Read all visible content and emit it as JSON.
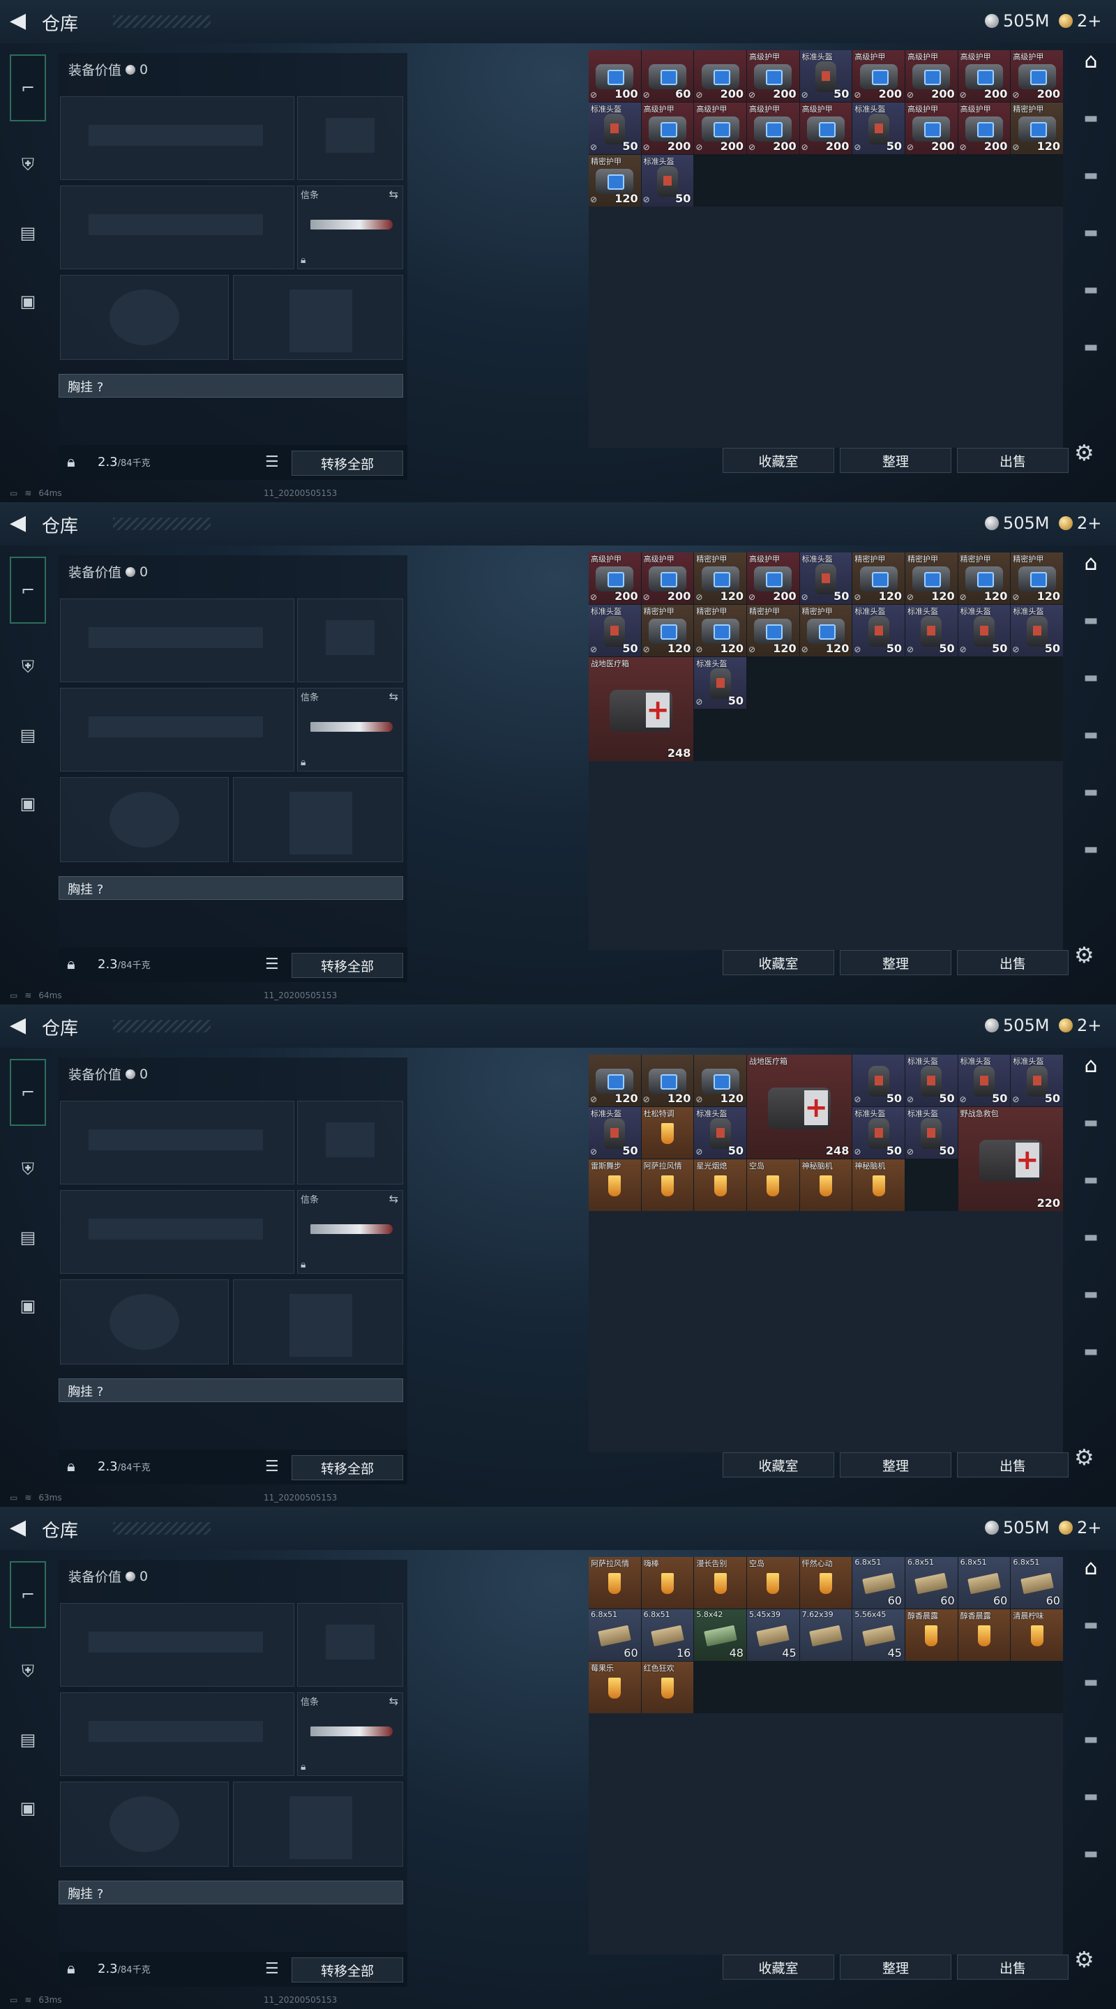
{
  "header": {
    "back": "<",
    "title": "仓库",
    "silver": "505M",
    "gold": "2+"
  },
  "left": {
    "equip_label": "装备价值",
    "equip_value": "0",
    "chest_label": "胸挂",
    "chest_q": "?",
    "knife_tag": "信条",
    "weight": "2.3",
    "weight_cap": "/84千克",
    "transfer": "转移全部"
  },
  "actions": {
    "collection": "收藏室",
    "sort": "整理",
    "sell": "出售"
  },
  "icons": {
    "back": "chevron-left-icon",
    "silver": "silver-coin-icon",
    "gold": "gold-coin-icon",
    "gear": "gear-icon"
  },
  "frames": [
    {
      "status": "64ms",
      "build": "11_20200505153",
      "cells": [
        {
          "t": "armor",
          "n": "",
          "v": "100"
        },
        {
          "t": "armor",
          "n": "",
          "v": "60"
        },
        {
          "t": "armor",
          "n": "",
          "v": "200"
        },
        {
          "t": "armor",
          "n": "高级护甲",
          "v": "200"
        },
        {
          "t": "helm",
          "n": "标准头盔",
          "v": "50"
        },
        {
          "t": "armor",
          "n": "高级护甲",
          "v": "200"
        },
        {
          "t": "armor",
          "n": "高级护甲",
          "v": "200"
        },
        {
          "t": "armor",
          "n": "高级护甲",
          "v": "200"
        },
        {
          "t": "armor",
          "n": "高级护甲",
          "v": "200"
        },
        {
          "t": "helm",
          "n": "标准头盔",
          "v": "50"
        },
        {
          "t": "armor",
          "n": "高级护甲",
          "v": "200"
        },
        {
          "t": "armor",
          "n": "高级护甲",
          "v": "200"
        },
        {
          "t": "armor",
          "n": "高级护甲",
          "v": "200"
        },
        {
          "t": "armor",
          "n": "高级护甲",
          "v": "200"
        },
        {
          "t": "helm",
          "n": "标准头盔",
          "v": "50"
        },
        {
          "t": "armor",
          "n": "高级护甲",
          "v": "200"
        },
        {
          "t": "armor",
          "n": "高级护甲",
          "v": "200"
        },
        {
          "t": "prec",
          "n": "精密护甲",
          "v": "120"
        },
        {
          "t": "prec",
          "n": "精密护甲",
          "v": "120"
        },
        {
          "t": "helm",
          "n": "标准头盔",
          "v": "50"
        }
      ]
    },
    {
      "status": "64ms",
      "build": "11_20200505153",
      "cells": [
        {
          "t": "armor",
          "n": "高级护甲",
          "v": "200"
        },
        {
          "t": "armor",
          "n": "高级护甲",
          "v": "200"
        },
        {
          "t": "prec",
          "n": "精密护甲",
          "v": "120"
        },
        {
          "t": "armor",
          "n": "高级护甲",
          "v": "200"
        },
        {
          "t": "helm",
          "n": "标准头盔",
          "v": "50"
        },
        {
          "t": "prec",
          "n": "精密护甲",
          "v": "120"
        },
        {
          "t": "prec",
          "n": "精密护甲",
          "v": "120"
        },
        {
          "t": "prec",
          "n": "精密护甲",
          "v": "120"
        },
        {
          "t": "prec",
          "n": "精密护甲",
          "v": "120"
        },
        {
          "t": "helm",
          "n": "标准头盔",
          "v": "50"
        },
        {
          "t": "prec",
          "n": "精密护甲",
          "v": "120"
        },
        {
          "t": "prec",
          "n": "精密护甲",
          "v": "120"
        },
        {
          "t": "prec",
          "n": "精密护甲",
          "v": "120"
        },
        {
          "t": "prec",
          "n": "精密护甲",
          "v": "120"
        },
        {
          "t": "helm",
          "n": "标准头盔",
          "v": "50"
        },
        {
          "t": "helm",
          "n": "标准头盔",
          "v": "50"
        },
        {
          "t": "helm",
          "n": "标准头盔",
          "v": "50"
        },
        {
          "t": "helm",
          "n": "标准头盔",
          "v": "50"
        },
        {
          "t": "med",
          "n": "战地医疗箱",
          "v": "248"
        },
        {
          "t": "helm",
          "n": "标准头盔",
          "v": "50"
        }
      ]
    },
    {
      "status": "63ms",
      "build": "11_20200505153",
      "cells": [
        {
          "t": "prec",
          "n": "",
          "v": "120"
        },
        {
          "t": "prec",
          "n": "",
          "v": "120"
        },
        {
          "t": "prec",
          "n": "",
          "v": "120"
        },
        {
          "t": "med",
          "n": "战地医疗箱",
          "v": "248"
        },
        {
          "t": "helm",
          "n": "",
          "v": "50"
        },
        {
          "t": "helm",
          "n": "标准头盔",
          "v": "50"
        },
        {
          "t": "helm",
          "n": "标准头盔",
          "v": "50"
        },
        {
          "t": "helm",
          "n": "标准头盔",
          "v": "50"
        },
        {
          "t": "helm",
          "n": "标准头盔",
          "v": "50"
        },
        {
          "t": "drink",
          "n": "杜松特调",
          "v": ""
        },
        {
          "t": "helm",
          "n": "标准头盔",
          "v": "50"
        },
        {
          "t": "helm",
          "n": "标准头盔",
          "v": "50"
        },
        {
          "t": "helm",
          "n": "标准头盔",
          "v": "50"
        },
        {
          "t": "med",
          "n": "野战急救包",
          "v": "220"
        },
        {
          "t": "drink",
          "n": "雷斯舞步",
          "v": ""
        },
        {
          "t": "drink",
          "n": "阿萨拉风情",
          "v": ""
        },
        {
          "t": "drink",
          "n": "星光烟熄",
          "v": ""
        },
        {
          "t": "drink",
          "n": "空岛",
          "v": ""
        },
        {
          "t": "drink",
          "n": "神秘脑机",
          "v": ""
        },
        {
          "t": "drink",
          "n": "神秘脑机",
          "v": ""
        }
      ]
    },
    {
      "status": "63ms",
      "build": "11_20200505153",
      "cells": [
        {
          "t": "drink",
          "n": "阿萨拉风情",
          "v": ""
        },
        {
          "t": "drink",
          "n": "嗨棒",
          "v": ""
        },
        {
          "t": "drink",
          "n": "漫长告别",
          "v": ""
        },
        {
          "t": "drink",
          "n": "空岛",
          "v": ""
        },
        {
          "t": "drink",
          "n": "怦然心动",
          "v": ""
        },
        {
          "t": "ammo",
          "n": "6.8x51",
          "v": "60"
        },
        {
          "t": "ammo",
          "n": "6.8x51",
          "v": "60"
        },
        {
          "t": "ammo",
          "n": "6.8x51",
          "v": "60"
        },
        {
          "t": "ammo",
          "n": "6.8x51",
          "v": "60"
        },
        {
          "t": "ammo",
          "n": "6.8x51",
          "v": "60"
        },
        {
          "t": "ammo",
          "n": "6.8x51",
          "v": "16"
        },
        {
          "t": "ammog",
          "n": "5.8x42",
          "v": "48"
        },
        {
          "t": "ammo",
          "n": "5.45x39",
          "v": "45"
        },
        {
          "t": "ammo",
          "n": "7.62x39",
          "v": ""
        },
        {
          "t": "ammo",
          "n": "5.56x45",
          "v": "45"
        },
        {
          "t": "drink",
          "n": "醇香晨露",
          "v": ""
        },
        {
          "t": "drink",
          "n": "醇香晨露",
          "v": ""
        },
        {
          "t": "drink",
          "n": "清晨柠味",
          "v": ""
        },
        {
          "t": "drink",
          "n": "莓果乐",
          "v": ""
        },
        {
          "t": "drink",
          "n": "红色狂欢",
          "v": ""
        }
      ]
    }
  ]
}
